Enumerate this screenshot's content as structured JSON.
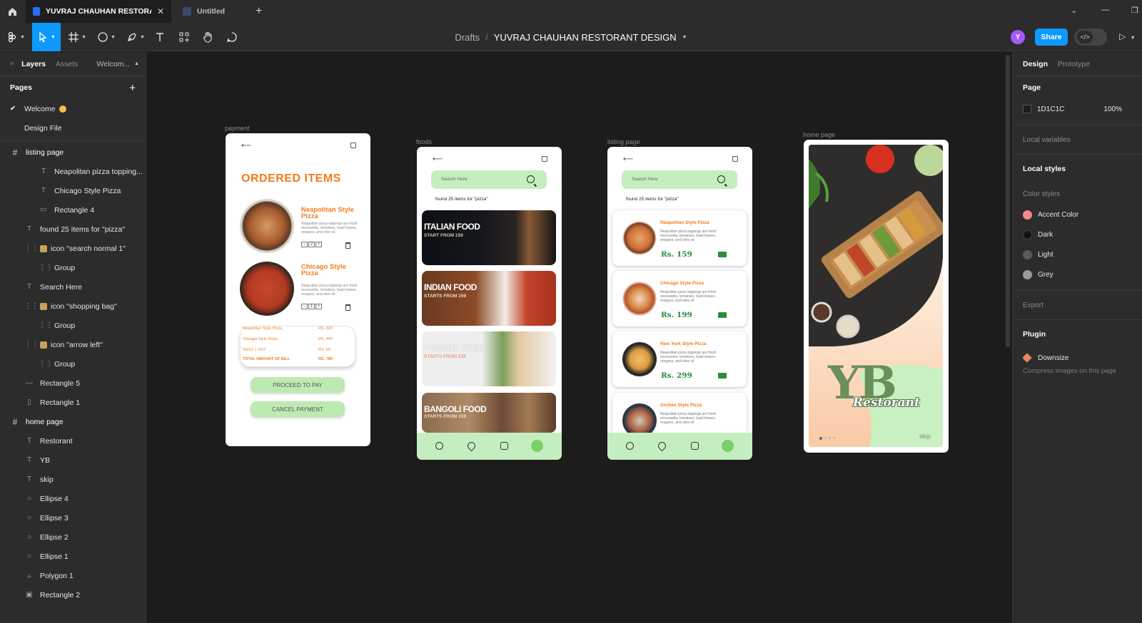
{
  "titlebar": {
    "tabs": [
      {
        "label": "YUVRAJ CHAUHAN RESTORANT D"
      },
      {
        "label": "Untitled"
      }
    ],
    "new_tab": "+"
  },
  "toolbar": {
    "breadcrumb": {
      "folder": "Drafts",
      "file": "YUVRAJ CHAUHAN RESTORANT DESIGN"
    },
    "avatar_initial": "Y",
    "share_label": "Share",
    "colors": {
      "accent": "#0d99ff",
      "avatar": "#a259ff"
    }
  },
  "left_panel": {
    "tabs": {
      "layers": "Layers",
      "assets": "Assets",
      "page": "Welcom..."
    },
    "pages_heading": "Pages",
    "pages": [
      {
        "label": "Welcome",
        "selected": true
      },
      {
        "label": "Design File",
        "selected": false
      }
    ],
    "layers": [
      {
        "label": "listing page",
        "type": "frame",
        "depth": 0
      },
      {
        "label": "Neapolitan pizza topping...",
        "type": "text",
        "depth": 2
      },
      {
        "label": "Chicago Style Pizza",
        "type": "text",
        "depth": 2
      },
      {
        "label": "Rectangle 4",
        "type": "rect",
        "depth": 2
      },
      {
        "label": "found 25 items for \"pizza\"",
        "type": "text",
        "depth": 1
      },
      {
        "label": "icon \"search normal 1\"",
        "type": "component",
        "depth": 1
      },
      {
        "label": "Group",
        "type": "group",
        "depth": 2
      },
      {
        "label": "Search Here",
        "type": "text",
        "depth": 1
      },
      {
        "label": "icon \"shopping bag\"",
        "type": "component",
        "depth": 1
      },
      {
        "label": "Group",
        "type": "group",
        "depth": 2
      },
      {
        "label": "icon \"arrow left\"",
        "type": "component",
        "depth": 1
      },
      {
        "label": "Group",
        "type": "group",
        "depth": 2
      },
      {
        "label": "Rectangle 5",
        "type": "line",
        "depth": 1
      },
      {
        "label": "Rectangle 1",
        "type": "rect-v",
        "depth": 1
      },
      {
        "label": "home page",
        "type": "frame",
        "depth": 0
      },
      {
        "label": "Restorant",
        "type": "text",
        "depth": 1
      },
      {
        "label": "YB",
        "type": "text",
        "depth": 1
      },
      {
        "label": "skip",
        "type": "text",
        "depth": 1
      },
      {
        "label": "Ellipse 4",
        "type": "ellipse",
        "depth": 1
      },
      {
        "label": "Ellipse 3",
        "type": "ellipse",
        "depth": 1
      },
      {
        "label": "Ellipse 2",
        "type": "ellipse",
        "depth": 1
      },
      {
        "label": "Ellipse 1",
        "type": "ellipse",
        "depth": 1
      },
      {
        "label": "Polygon 1",
        "type": "polygon",
        "depth": 1
      },
      {
        "label": "Rectangle 2",
        "type": "image",
        "depth": 1
      }
    ]
  },
  "canvas": {
    "frames": {
      "payment": {
        "label": "payment",
        "title": "ORDERED ITEMS",
        "items": [
          {
            "name": "Neapolitan Style Pizza",
            "desc": "Neapolitan pizza toppings are fresh mozzarella, tomatoes, basil leaves, oregano, and olive oil",
            "qty": "2"
          },
          {
            "name": "Chicago Style Pizza",
            "desc": "Neapolitan pizza toppings are fresh mozzarella, tomatoes, basil leaves, oregano, and olive oil",
            "qty": "1"
          }
        ],
        "qty_minus": "−",
        "qty_plus": "+",
        "bill": [
          {
            "label": "Neapolitan Style Pizza",
            "value": "RS. 320"
          },
          {
            "label": "Chicago Style Pizza",
            "value": "RS. 400"
          },
          {
            "label": "SGST + GST",
            "value": "RS. 60"
          },
          {
            "label": "TOTAL AMOUNT OF BILL",
            "value": "RS. 780"
          }
        ],
        "proceed_label": "PROCEED TO PAY",
        "cancel_label": "CANCEL PAYMENT"
      },
      "foods": {
        "label": "foods",
        "search_placeholder": "Search Here",
        "found_text": "found 25 items for \"pizza\"",
        "categories": [
          {
            "title": "ITALIAN FOOD",
            "sub": "START FROM 159"
          },
          {
            "title": "INDIAN FOOD",
            "sub": "STARTS FROM 159"
          },
          {
            "title": "PANJABI FOOD",
            "sub": "STARTS FROM 159"
          },
          {
            "title": "BANGOLI FOOD",
            "sub": "STARTS FROM 159"
          }
        ]
      },
      "listing": {
        "label": "listing page",
        "search_placeholder": "Search Here",
        "found_text": "found 25 items for \"pizza\"",
        "items": [
          {
            "name": "Neapolitan Style Pizza",
            "desc": "Neapolitan pizza toppings are fresh mozzarella, tomatoes, basil leaves, oregano, and olive oil",
            "price": "Rs. 159"
          },
          {
            "name": "Chicago Style Pizza",
            "desc": "Neapolitan pizza toppings are fresh mozzarella, tomatoes, basil leaves, oregano, and olive oil",
            "price": "Rs. 199"
          },
          {
            "name": "New York Style Pizza",
            "desc": "Neapolitan pizza toppings are fresh mozzarella, tomatoes, basil leaves, oregano, and olive oil",
            "price": "Rs. 299"
          },
          {
            "name": "Sicilian Style Pizza",
            "desc": "Neapolitan pizza toppings are fresh mozzarella, tomatoes, basil leaves, oregano, and olive oil",
            "price": ""
          }
        ]
      },
      "home": {
        "label": "home page",
        "logo": "YB",
        "tagline": "Restorant",
        "skip": "skip"
      }
    },
    "colors": {
      "canvas_bg": "#1d1c1c",
      "accent_orange": "#f37b1d",
      "app_green": "#c5eec0",
      "price_green": "#2e8b3a"
    }
  },
  "right_panel": {
    "tabs": {
      "design": "Design",
      "prototype": "Prototype"
    },
    "page_heading": "Page",
    "page_color": {
      "hex": "1D1C1C",
      "opacity": "100%",
      "swatch": "#1d1c1c"
    },
    "local_variables": "Local variables",
    "local_styles": "Local styles",
    "color_styles_heading": "Color styles",
    "color_styles": [
      {
        "name": "Accent Color",
        "color": "#f4878a"
      },
      {
        "name": "Dark",
        "color": "#111111"
      },
      {
        "name": "Light",
        "color": "#5a5a5a"
      },
      {
        "name": "Grey",
        "color": "#9a9a9a"
      }
    ],
    "export": "Export",
    "plugin_heading": "Plugin",
    "plugin": {
      "name": "Downsize",
      "desc": "Compress images on this page"
    }
  }
}
